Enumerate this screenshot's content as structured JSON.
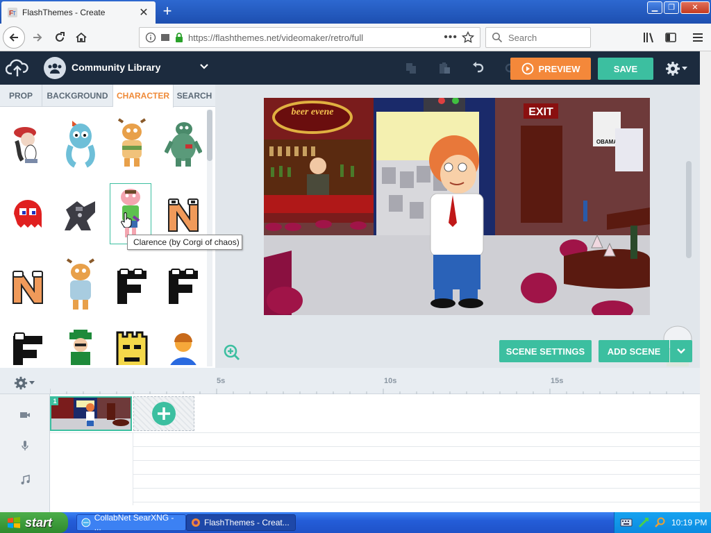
{
  "browser": {
    "tab_title": "FlashThemes - Create",
    "url": "https://flashthemes.net/videomaker/retro/full",
    "search_placeholder": "Search",
    "new_tab_symbol": "+",
    "close_symbol": "✕"
  },
  "header": {
    "library_title": "Community Library",
    "preview_label": "PREVIEW",
    "save_label": "SAVE"
  },
  "tabs": [
    "PROP",
    "BACKGROUND",
    "CHARACTER",
    "SEARCH"
  ],
  "active_tab": "CHARACTER",
  "tooltip": "Clarence (by Corgi of chaos)",
  "stage": {
    "sign_text": "beer evene",
    "exit_text": "EXIT",
    "poster_text": "OBAMA"
  },
  "buttons": {
    "scene_settings": "SCENE SETTINGS",
    "add_scene": "ADD SCENE"
  },
  "timeline": {
    "ticks": [
      "5s",
      "10s",
      "15s"
    ],
    "scene_number": "1"
  },
  "taskbar": {
    "start_label": "start",
    "tasks": [
      "CollabNet SearXNG - ...",
      "FlashThemes - Creat..."
    ],
    "clock": "10:19 PM"
  },
  "colors": {
    "accent_orange": "#f4883a",
    "accent_teal": "#3cbfa0",
    "header_navy": "#1c2b3e"
  }
}
